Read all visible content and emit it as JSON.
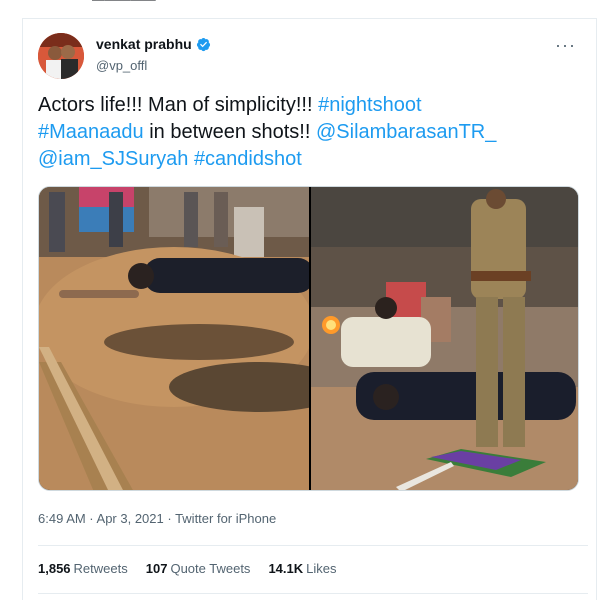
{
  "header": {
    "display_name": "venkat prabhu",
    "handle": "@vp_offl",
    "more_label": "···"
  },
  "tweet": {
    "line1_plain": "Actors life!!! Man of simplicity!!! ",
    "line1_tag": "#nightshoot",
    "line2_tag": "#Maanaadu",
    "line2_plain": " in between shots!! ",
    "line2_mention": "@SilambarasanTR_",
    "line3_mention": "@iam_SJSuryah",
    "line3_tag": "#candidshot"
  },
  "meta": {
    "timestamp": "6:49 AM · Apr 3, 2021 · Twitter for iPhone"
  },
  "stats": {
    "retweets_count": "1,856",
    "retweets_label": "Retweets",
    "quotes_count": "107",
    "quotes_label": "Quote Tweets",
    "likes_count": "14.1K",
    "likes_label": "Likes"
  },
  "colors": {
    "link": "#1d9bf0",
    "verified": "#1d9bf0",
    "secondary_text": "#536471"
  }
}
